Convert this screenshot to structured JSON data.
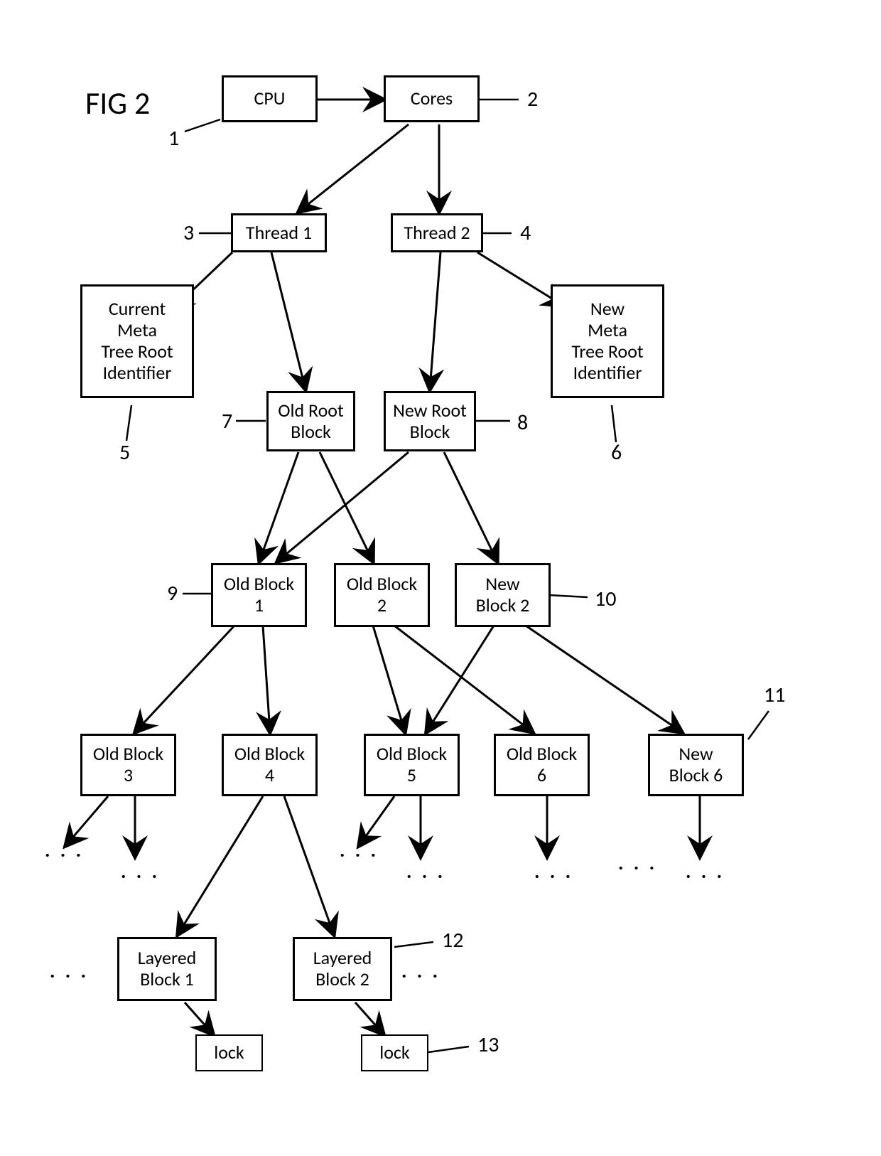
{
  "figure_title": "FIG 2",
  "nodes": {
    "cpu": "CPU",
    "cores": "Cores",
    "thread1": "Thread 1",
    "thread2": "Thread 2",
    "cur_meta": "Current\nMeta\nTree Root\nIdentifier",
    "new_meta": "New\nMeta\nTree Root\nIdentifier",
    "old_root": "Old Root\nBlock",
    "new_root": "New Root\nBlock",
    "old_b1": "Old Block\n1",
    "old_b2": "Old Block\n2",
    "new_b2": "New\nBlock 2",
    "old_b3": "Old Block\n3",
    "old_b4": "Old Block\n4",
    "old_b5": "Old Block\n5",
    "old_b6": "Old Block\n6",
    "new_b6": "New\nBlock 6",
    "lay_b1": "Layered\nBlock 1",
    "lay_b2": "Layered\nBlock 2",
    "lock1": "lock",
    "lock2": "lock"
  },
  "labels": {
    "n1": "1",
    "n2": "2",
    "n3": "3",
    "n4": "4",
    "n5": "5",
    "n6": "6",
    "n7": "7",
    "n8": "8",
    "n9": "9",
    "n10": "10",
    "n11": "11",
    "n12": "12",
    "n13": "13"
  },
  "ellipsis": ". . ."
}
